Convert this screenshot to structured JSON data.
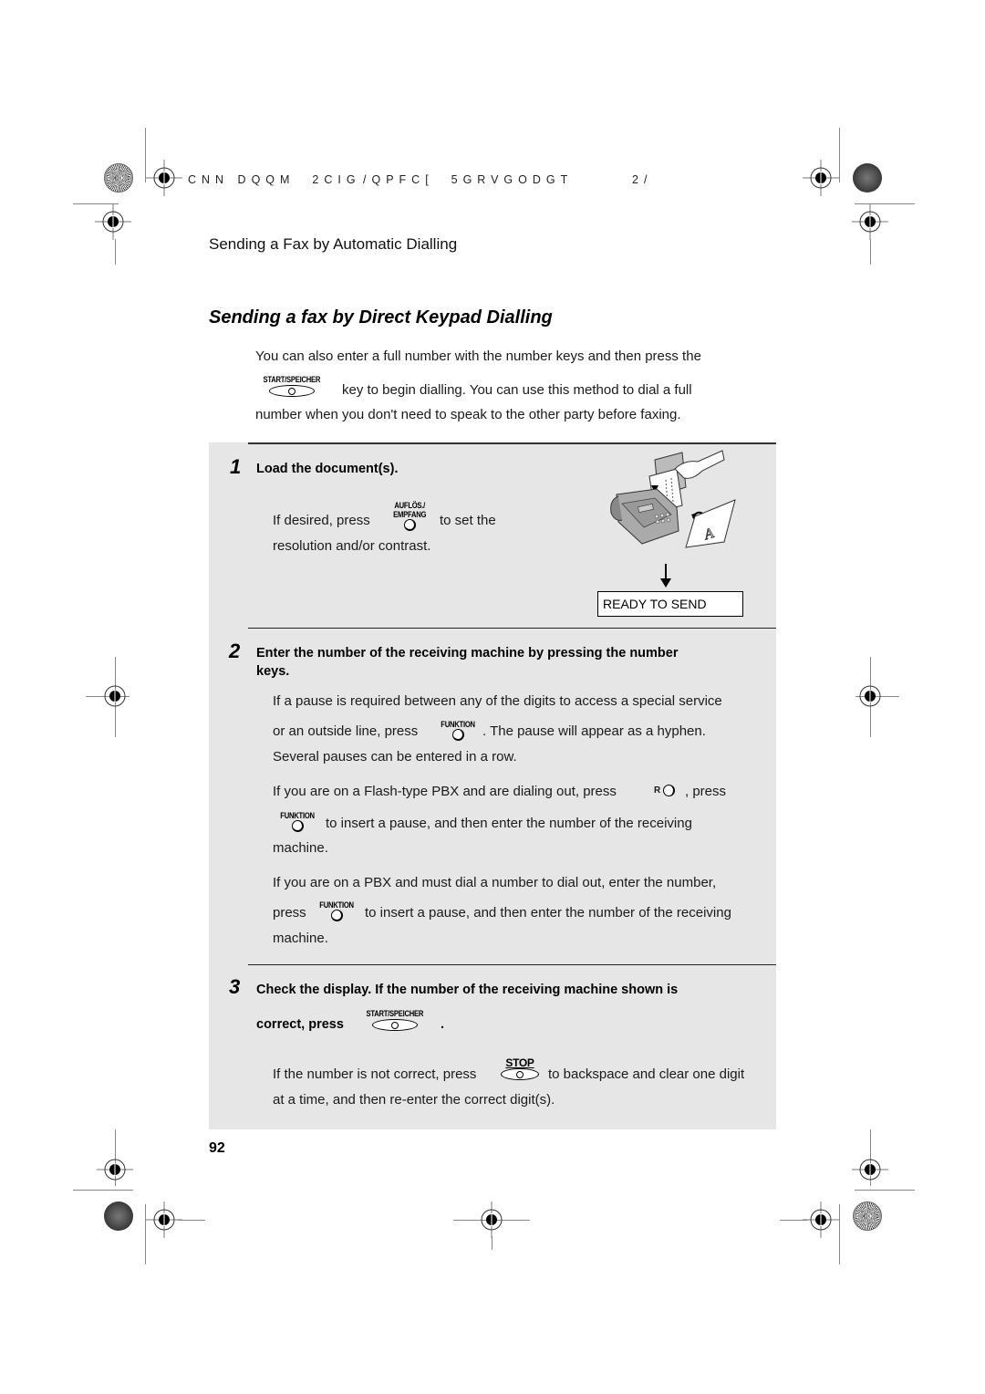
{
  "header": {
    "code_part1": "CNN DQQM  2CIG",
    "code_part2": "/QPFC[  5GRVGODGT",
    "code_part3": "2/"
  },
  "section_title": "Sending a Fax by Automatic Dialling",
  "heading": "Sending a fax by Direct Keypad Dialling",
  "intro": {
    "line1": "You can also enter a full number with the number keys and then press the",
    "key_label": "START/SPEICHER",
    "line2": "key to begin dialling. You can use this method to dial a full",
    "line3": "number when you don't need to speak to the other party before faxing."
  },
  "steps": [
    {
      "number": "1",
      "title": "Load the document(s).",
      "text_a": "If desired, press",
      "key_label_line1": "AUFLÖS./",
      "key_label_line2": "EMPFANG",
      "text_b": "to set the",
      "text_c": "resolution and/or contrast.",
      "display": "READY TO SEND"
    },
    {
      "number": "2",
      "title_line1": "Enter the number of the receiving machine by pressing the number",
      "title_line2": "keys.",
      "p1_line1": "If a pause is required between any of the digits to access a special service",
      "p1_line2a": "or an outside line, press",
      "p1_key": "FUNKTION",
      "p1_line2b": ". The pause will appear as a hyphen.",
      "p1_line3": "Several pauses can be entered in a row.",
      "p2_line1a": "If you are on a Flash-type PBX and are dialing out, press",
      "p2_rkey": "R",
      "p2_line1b": ", press",
      "p2_key": "FUNKTION",
      "p2_line2": "to insert a pause, and then enter the number of the receiving",
      "p2_line3": "machine.",
      "p3_line1": "If you are on a PBX and must dial a number to dial out, enter the number,",
      "p3_line2a": "press",
      "p3_key": "FUNKTION",
      "p3_line2b": "to insert a pause, and then enter the number of the receiving",
      "p3_line3": "machine."
    },
    {
      "number": "3",
      "title_line1": "Check the display. If the number of the receiving machine shown is",
      "title_line2a": "correct, press",
      "title_key": "START/SPEICHER",
      "title_line2b": ".",
      "p1_line1a": "If the number is not correct, press",
      "p1_key": "STOP",
      "p1_line1b": "to backspace and clear one digit",
      "p1_line2": "at a time, and then re-enter the correct digit(s)."
    }
  ],
  "page_number": "92"
}
